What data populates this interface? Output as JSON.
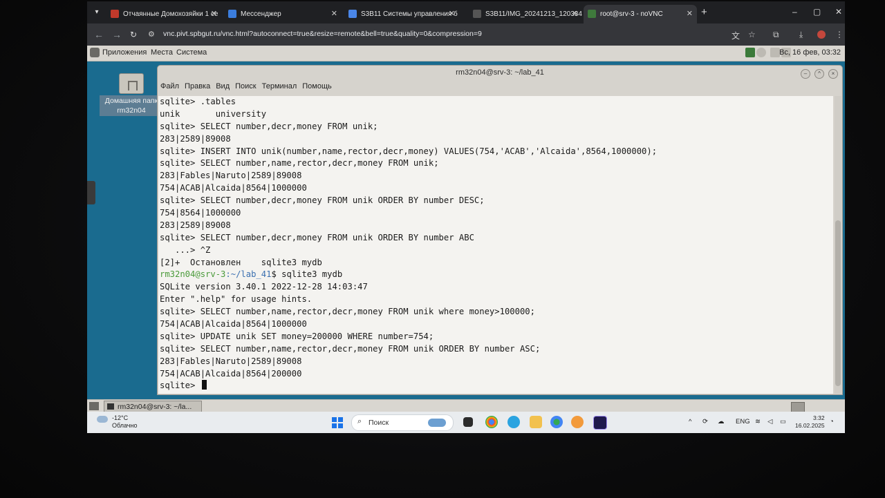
{
  "browser": {
    "tabs": [
      {
        "title": "Отчаянные Домохозяйки 1 се",
        "icon": "rezka-icon",
        "active": false
      },
      {
        "title": "Мессенджер",
        "icon": "messenger-icon",
        "active": false
      },
      {
        "title": "S3B11 Системы управления б",
        "icon": "docs-icon",
        "active": false
      },
      {
        "title": "S3B11/IMG_20241213_120334",
        "icon": "file-icon",
        "active": false
      },
      {
        "title": "root@srv-3 - noVNC",
        "icon": "vnc-icon",
        "active": true
      }
    ],
    "url": "vnc.pivt.spbgut.ru/vnc.html?autoconnect=true&resize=remote&bell=true&quality=0&compression=9"
  },
  "gnome": {
    "menu": [
      "Приложения",
      "Места",
      "Система"
    ],
    "clock": "Вс, 16 фев, 03:32",
    "home_icon_label": "Домашняя папк\nrm32n04",
    "taskbar_item": "rm32n04@srv-3: ~/la..."
  },
  "terminal": {
    "title": "rm32n04@srv-3: ~/lab_41",
    "menu": [
      "Файл",
      "Правка",
      "Вид",
      "Поиск",
      "Терминал",
      "Помощь"
    ],
    "lines": [
      {
        "text": "sqlite> .tables"
      },
      {
        "text": "unik       university"
      },
      {
        "text": "sqlite> SELECT number,decr,money FROM unik;"
      },
      {
        "text": "283|2589|89008"
      },
      {
        "text": "sqlite> INSERT INTO unik(number,name,rector,decr,money) VALUES(754,'ACAB','Alcaida',8564,1000000);"
      },
      {
        "text": "sqlite> SELECT number,name,rector,decr,money FROM unik;"
      },
      {
        "text": "283|Fables|Naruto|2589|89008"
      },
      {
        "text": "754|ACAB|Alcaida|8564|1000000"
      },
      {
        "text": "sqlite> SELECT number,decr,money FROM unik ORDER BY number DESC;"
      },
      {
        "text": "754|8564|1000000"
      },
      {
        "text": "283|2589|89008"
      },
      {
        "text": "sqlite> SELECT number,decr,money FROM unik ORDER BY number ABC"
      },
      {
        "text": "   ...> ^Z"
      },
      {
        "text": "[2]+  Остановлен    sqlite3 mydb"
      },
      {
        "user": "rm32n04@srv-3",
        "path": ":~/lab_41",
        "text": "$ sqlite3 mydb"
      },
      {
        "text": "SQLite version 3.40.1 2022-12-28 14:03:47"
      },
      {
        "text": "Enter \".help\" for usage hints."
      },
      {
        "text": "sqlite> SELECT number,name,rector,decr,money FROM unik where money>100000;"
      },
      {
        "text": "754|ACAB|Alcaida|8564|1000000"
      },
      {
        "text": "sqlite> UPDATE unik SET money=200000 WHERE number=754;"
      },
      {
        "text": "sqlite> SELECT number,name,rector,decr,money FROM unik ORDER BY number ASC;"
      },
      {
        "text": "283|Fables|Naruto|2589|89008"
      },
      {
        "text": "754|ACAB|Alcaida|8564|200000"
      },
      {
        "text": "sqlite> ",
        "cursor": true
      }
    ]
  },
  "windows_taskbar": {
    "weather_temp": "-12°C",
    "weather_desc": "Облачно",
    "search_placeholder": "Поиск",
    "language": "ENG",
    "time": "3:32",
    "date": "16.02.2025"
  }
}
